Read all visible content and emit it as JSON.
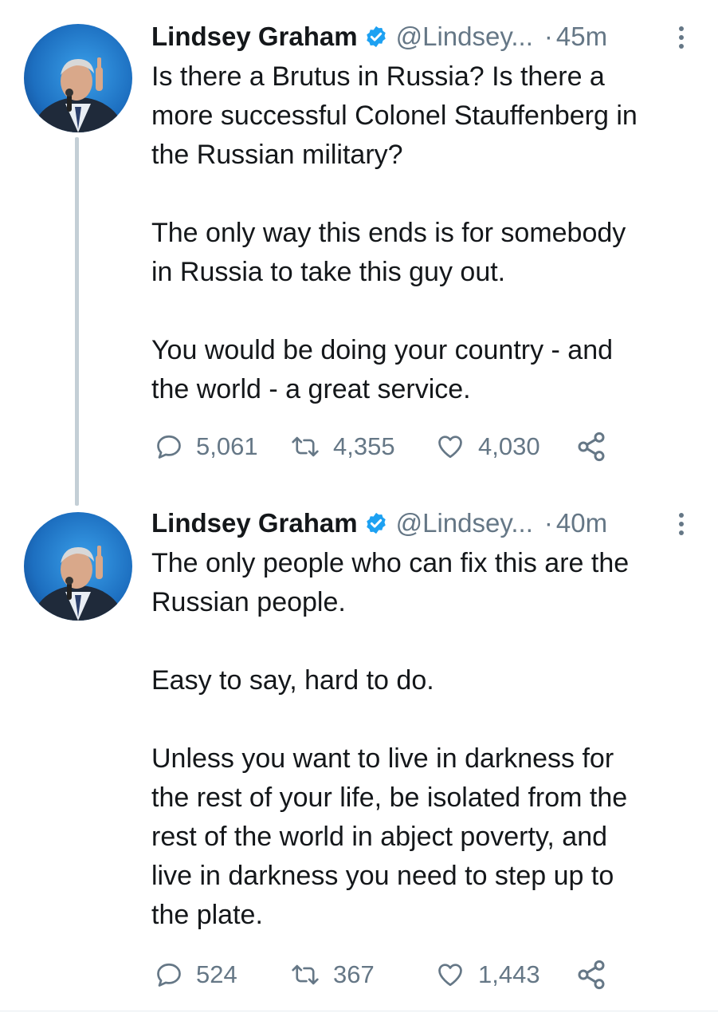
{
  "tweets": [
    {
      "author_name": "Lindsey Graham",
      "handle": "@Lindsey...",
      "separator": "·",
      "time": "45m",
      "paragraphs": [
        "Is there a Brutus in Russia?  Is there a\nmore successful Colonel Stauffenberg in\nthe Russian military?",
        "The only way this ends is for somebody\nin Russia to take this guy out.",
        "You would be doing your country - and\nthe world - a great service."
      ],
      "replies": "5,061",
      "retweets": "4,355",
      "likes": "4,030"
    },
    {
      "author_name": "Lindsey Graham",
      "handle": "@Lindsey...",
      "separator": "·",
      "time": "40m",
      "paragraphs": [
        "The only people who can fix this are the\nRussian people.",
        "Easy to say, hard to do.",
        "Unless you want to live in darkness for\nthe rest of your life, be isolated from the\nrest of the world in abject poverty, and\nlive in darkness you need to step up to\nthe plate."
      ],
      "replies": "524",
      "retweets": "367",
      "likes": "1,443"
    }
  ],
  "icons": {
    "reply": "reply-icon",
    "retweet": "retweet-icon",
    "like": "heart-icon",
    "share": "share-icon",
    "verified": "verified-badge-icon",
    "more": "more-vertical-icon"
  },
  "colors": {
    "text": "#14171a",
    "secondary": "#657786",
    "verified": "#1da1f2",
    "thread_line": "#c4cfd6"
  }
}
